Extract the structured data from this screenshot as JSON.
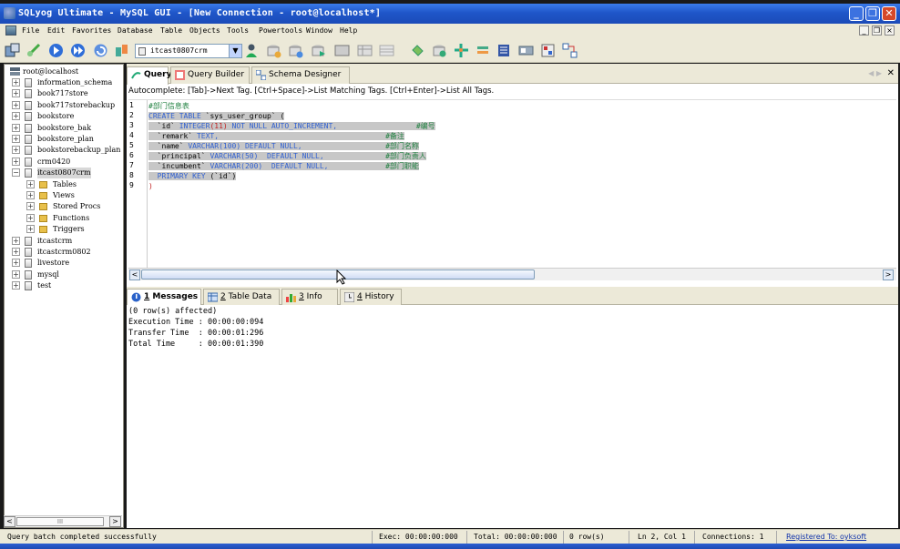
{
  "window": {
    "title": "SQLyog Ultimate - MySQL GUI - [New Connection - root@localhost*]"
  },
  "menu": [
    "File",
    "Edit",
    "Favorites",
    "Database",
    "Table",
    "Objects",
    "Tools",
    "Powertools",
    "Window",
    "Help"
  ],
  "toolbar": {
    "database_select": "itcast0807crm"
  },
  "object_browser": {
    "root": "root@localhost",
    "databases": [
      "information_schema",
      "book717store",
      "book717storebackup",
      "bookstore",
      "bookstore_bak",
      "bookstore_plan",
      "bookstorebackup_plan",
      "crm0420",
      "itcast0807crm"
    ],
    "expanded_children": [
      "Tables",
      "Views",
      "Stored Procs",
      "Functions",
      "Triggers"
    ],
    "databases_after": [
      "itcastcrm",
      "itcastcrm0802",
      "livestore",
      "mysql",
      "test"
    ],
    "scroll_thumb": "III"
  },
  "top_tabs": [
    "Query",
    "Query Builder",
    "Schema Designer"
  ],
  "autocomplete_hint": "Autocomplete: [Tab]->Next Tag. [Ctrl+Space]->List Matching Tags. [Ctrl+Enter]->List All Tags.",
  "editor": {
    "line_numbers": [
      "1",
      "2",
      "3",
      "4",
      "5",
      "6",
      "7",
      "8",
      "9"
    ],
    "lines": {
      "l1": "#部门信息表",
      "l2a": "CREATE TABLE ",
      "l2b": "`sys_user_group` (",
      "l3a": "  `id` ",
      "l3b": "INTEGER",
      "l3c": "(11)",
      "l3d": " NOT NULL AUTO_INCREMENT,",
      "l3e": "#编号",
      "l4a": "  `remark` ",
      "l4b": "TEXT,",
      "l4e": "#备注",
      "l5a": "  `name` ",
      "l5b": "VARCHAR(100) DEFAULT NULL,",
      "l5e": "#部门名称",
      "l6a": "  `principal` ",
      "l6b": "VARCHAR(50)  DEFAULT NULL,",
      "l6e": "#部门负责人",
      "l7a": "  `incumbent` ",
      "l7b": "VARCHAR(200)  DEFAULT NULL,",
      "l7e": "#部门职能",
      "l8a": "  PRIMARY KEY ",
      "l8b": "(`id`)",
      "l9": ")"
    }
  },
  "bottom_tabs": [
    {
      "num": "1",
      "label": " Messages"
    },
    {
      "num": "2",
      "label": " Table Data"
    },
    {
      "num": "3",
      "label": " Info"
    },
    {
      "num": "4",
      "label": " History"
    }
  ],
  "messages": [
    "(0 row(s) affected)",
    "Execution Time : 00:00:00:094",
    "Transfer Time  : 00:00:01:296",
    "Total Time     : 00:00:01:390"
  ],
  "status": {
    "message": "Query batch completed successfully",
    "exec": "Exec: 00:00:00:000",
    "total": "Total: 00:00:00:000",
    "rows": "0 row(s)",
    "position": "Ln 2, Col 1",
    "connections": "Connections: 1",
    "registered": "Registered To: oyksoft"
  },
  "colors": {
    "titlebar": "#1f56c9",
    "chrome": "#ece9d8",
    "selection": "#c7c7c7",
    "keyword": "#3060d0",
    "comment": "#208040"
  }
}
